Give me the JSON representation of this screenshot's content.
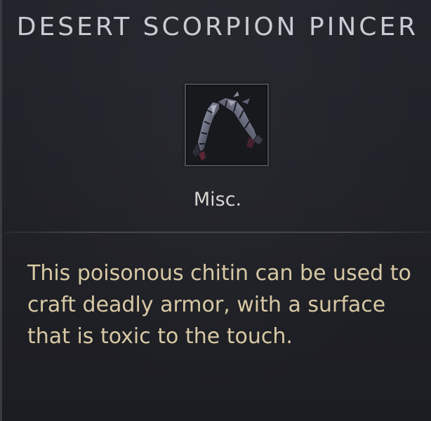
{
  "tooltip": {
    "item_name": "DESERT SCORPION PINCER",
    "item_type": "Misc.",
    "description": "This poisonous chitin can be used to craft deadly armor, with a surface that is toxic to the touch.",
    "icon": "scorpion-pincer-icon",
    "colors": {
      "background": "#202127",
      "name_text": "#c9cbd3",
      "type_text": "#d7d6d0",
      "description_text": "#d8c9a4"
    }
  }
}
